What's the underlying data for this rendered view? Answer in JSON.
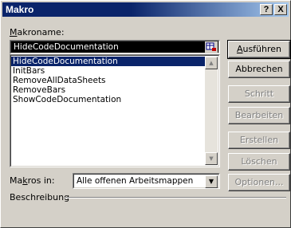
{
  "window": {
    "title": "Makro",
    "help_btn": "?",
    "close_btn": "X"
  },
  "macro_name": {
    "label_prefix": "",
    "label_underlined": "M",
    "label_rest": "akroname:",
    "value": "HideCodeDocumentation",
    "browse_icon": "ref-edit-icon"
  },
  "macros": {
    "items": [
      "HideCodeDocumentation",
      "InitBars",
      "RemoveAllDataSheets",
      "RemoveBars",
      "ShowCodeDocumentation"
    ],
    "selected_index": 0
  },
  "buttons": {
    "run": {
      "prefix": "",
      "ul": "A",
      "rest": "usführen"
    },
    "cancel": "Abbrechen",
    "step": "Schritt",
    "edit": "Bearbeiten",
    "create": "Erstellen",
    "delete": "Löschen",
    "options": "Optionen..."
  },
  "macros_in": {
    "label_prefix": "Ma",
    "label_underlined": "k",
    "label_rest": "ros in:",
    "value": "Alle offenen Arbeitsmappen"
  },
  "description": {
    "label": "Beschreibung"
  },
  "colors": {
    "face": "#d4d0c8",
    "selection": "#0a246a",
    "title_gradient_start": "#0a246a",
    "title_gradient_end": "#a6caf0",
    "disabled_text": "#808080"
  }
}
